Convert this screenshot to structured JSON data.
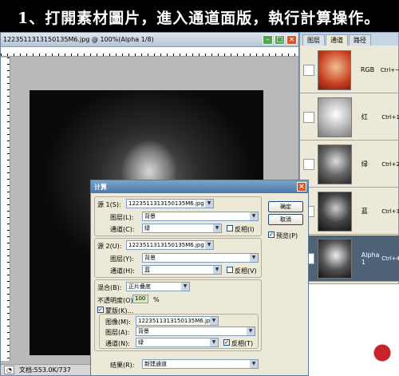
{
  "banner": {
    "text": "1、打開素材圖片，進入通道面版，執行計算操作。"
  },
  "document": {
    "title": "1223511313150135M6.jpg @ 100%(Alpha 1/8)",
    "status_text": "文档:553.0K/737"
  },
  "channels_panel": {
    "tabs": [
      "图层",
      "通道",
      "路径"
    ],
    "channels": [
      {
        "name": "RGB",
        "shortcut": "Ctrl+~"
      },
      {
        "name": "红",
        "shortcut": "Ctrl+1"
      },
      {
        "name": "绿",
        "shortcut": "Ctrl+2"
      },
      {
        "name": "蓝",
        "shortcut": "Ctrl+3"
      },
      {
        "name": "Alpha 1",
        "shortcut": "Ctrl+4"
      }
    ]
  },
  "dialog": {
    "title": "计算",
    "source1": {
      "label": "源 1(S):",
      "file": "1223511313150135M6.jpg",
      "layer_label": "图层(L):",
      "layer": "背景",
      "channel_label": "通道(C):",
      "channel": "绿",
      "invert_label": "反相(I)"
    },
    "source2": {
      "label": "源 2(U):",
      "file": "1223511313150135M6.jpg",
      "layer_label": "图层(Y):",
      "layer": "背景",
      "channel_label": "通道(H):",
      "channel": "蓝",
      "invert_label": "反相(V)"
    },
    "blending": {
      "label": "混合(B):",
      "mode": "正片叠底",
      "opacity_label": "不透明度(O):",
      "opacity": "100",
      "opacity_unit": "%",
      "mask_label": "蒙版(K)...",
      "mask_image_label": "图像(M):",
      "mask_image": "1223511313150135M6.jpg",
      "mask_layer_label": "图层(A):",
      "mask_layer": "背景",
      "mask_channel_label": "通道(N):",
      "mask_channel": "绿",
      "mask_invert_label": "反相(T)"
    },
    "result": {
      "label": "结果(R):",
      "value": "新建通道"
    },
    "ok_label": "确定",
    "cancel_label": "取消",
    "preview_label": "预览(P)"
  }
}
